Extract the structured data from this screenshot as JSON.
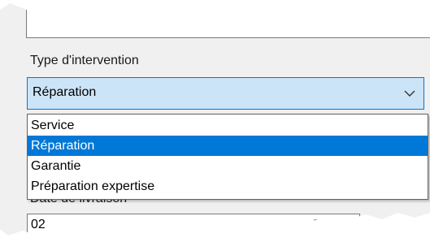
{
  "form": {
    "intervention_label": "Type d'intervention",
    "intervention_selected": "Réparation",
    "options": [
      "Service",
      "Réparation",
      "Garantie",
      "Préparation expertise"
    ],
    "highlighted_option": "Réparation",
    "delivery_label": "Date de livraison",
    "delivery_value": "02"
  },
  "icons": {
    "combo_arrow": "chevron-down-icon",
    "date_picker": "calendar-icon"
  },
  "colors": {
    "selection": "#0078d7",
    "combo_bg": "#cce4f7",
    "panel_bg": "#f0f0f0"
  }
}
